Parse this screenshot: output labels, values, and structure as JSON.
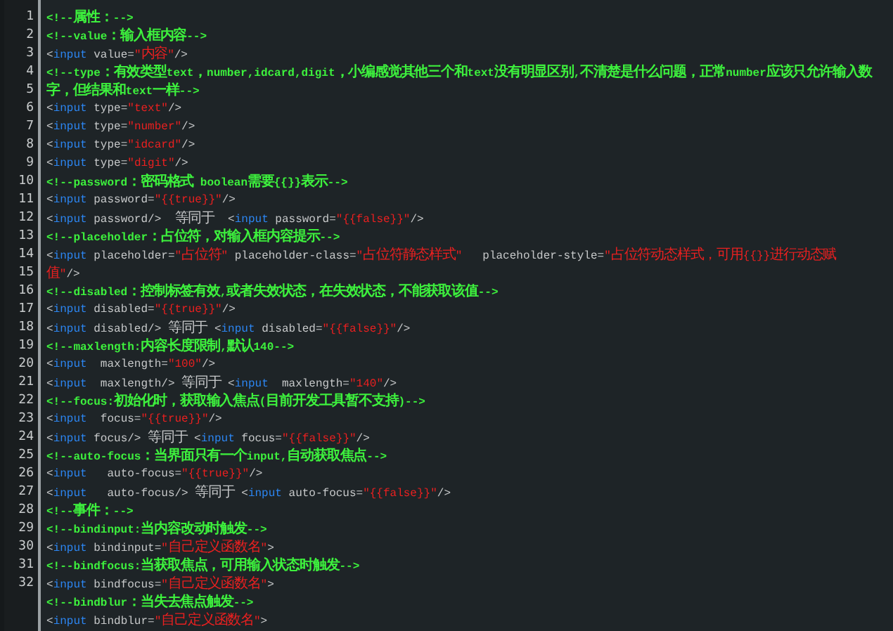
{
  "editor": {
    "rows": [
      {
        "number": "1",
        "tokens": [
          {
            "kind": "comment",
            "text": "<!--属性：-->"
          }
        ]
      },
      {
        "number": "2",
        "tokens": [
          {
            "kind": "comment",
            "text": "<!--value：输入框内容-->"
          }
        ]
      },
      {
        "number": "3",
        "tokens": [
          {
            "kind": "plain",
            "text": "<"
          },
          {
            "kind": "tag",
            "text": "input"
          },
          {
            "kind": "plain",
            "text": " value="
          },
          {
            "kind": "string",
            "text": "\"内容\""
          },
          {
            "kind": "plain",
            "text": "/>"
          }
        ]
      },
      {
        "number": "4",
        "tokens": [
          {
            "kind": "comment",
            "text": "<!--type：有效类型text，number,idcard,digit，小编感觉其他三个和text没有明显区别,不清楚是什么问题，正常number应该只允许输入数"
          }
        ]
      },
      {
        "number": "5",
        "tokens": [
          {
            "kind": "comment",
            "text": "字，但结果和text一样-->"
          }
        ]
      },
      {
        "number": "6",
        "tokens": [
          {
            "kind": "plain",
            "text": "<"
          },
          {
            "kind": "tag",
            "text": "input"
          },
          {
            "kind": "plain",
            "text": " type="
          },
          {
            "kind": "string",
            "text": "\"text\""
          },
          {
            "kind": "plain",
            "text": "/>"
          }
        ]
      },
      {
        "number": "7",
        "tokens": [
          {
            "kind": "plain",
            "text": "<"
          },
          {
            "kind": "tag",
            "text": "input"
          },
          {
            "kind": "plain",
            "text": " type="
          },
          {
            "kind": "string",
            "text": "\"number\""
          },
          {
            "kind": "plain",
            "text": "/>"
          }
        ]
      },
      {
        "number": "8",
        "tokens": [
          {
            "kind": "plain",
            "text": "<"
          },
          {
            "kind": "tag",
            "text": "input"
          },
          {
            "kind": "plain",
            "text": " type="
          },
          {
            "kind": "string",
            "text": "\"idcard\""
          },
          {
            "kind": "plain",
            "text": "/>"
          }
        ]
      },
      {
        "number": "9",
        "tokens": [
          {
            "kind": "plain",
            "text": "<"
          },
          {
            "kind": "tag",
            "text": "input"
          },
          {
            "kind": "plain",
            "text": " type="
          },
          {
            "kind": "string",
            "text": "\"digit\""
          },
          {
            "kind": "plain",
            "text": "/>"
          }
        ]
      },
      {
        "number": "10",
        "tokens": [
          {
            "kind": "comment",
            "text": "<!--password：密码格式 boolean需要{{}}表示-->"
          }
        ]
      },
      {
        "number": "11",
        "tokens": [
          {
            "kind": "plain",
            "text": "<"
          },
          {
            "kind": "tag",
            "text": "input"
          },
          {
            "kind": "plain",
            "text": " password="
          },
          {
            "kind": "string",
            "text": "\"{{true}}\""
          },
          {
            "kind": "plain",
            "text": "/>"
          }
        ]
      },
      {
        "number": "12",
        "tokens": [
          {
            "kind": "plain",
            "text": "<"
          },
          {
            "kind": "tag",
            "text": "input"
          },
          {
            "kind": "plain",
            "text": " password/>  等同于  <"
          },
          {
            "kind": "tag",
            "text": "input"
          },
          {
            "kind": "plain",
            "text": " password="
          },
          {
            "kind": "string",
            "text": "\"{{false}}\""
          },
          {
            "kind": "plain",
            "text": "/>"
          }
        ]
      },
      {
        "number": "13",
        "tokens": [
          {
            "kind": "comment",
            "text": "<!--placeholder：占位符，对输入框内容提示-->"
          }
        ]
      },
      {
        "number": "14",
        "tokens": [
          {
            "kind": "plain",
            "text": "<"
          },
          {
            "kind": "tag",
            "text": "input"
          },
          {
            "kind": "plain",
            "text": " placeholder="
          },
          {
            "kind": "string",
            "text": "\"占位符\""
          },
          {
            "kind": "plain",
            "text": " placeholder-class="
          },
          {
            "kind": "string",
            "text": "\"占位符静态样式\""
          },
          {
            "kind": "plain",
            "text": "   placeholder-style="
          },
          {
            "kind": "string",
            "text": "\"占位符动态样式，可用{{}}进行动态赋"
          }
        ]
      },
      {
        "number": "15",
        "tokens": [
          {
            "kind": "string",
            "text": "值\""
          },
          {
            "kind": "plain",
            "text": "/>"
          }
        ]
      },
      {
        "number": "16",
        "tokens": [
          {
            "kind": "comment",
            "text": "<!--disabled：控制标签有效,或者失效状态，在失效状态，不能获取该值-->"
          }
        ]
      },
      {
        "number": "17",
        "tokens": [
          {
            "kind": "plain",
            "text": "<"
          },
          {
            "kind": "tag",
            "text": "input"
          },
          {
            "kind": "plain",
            "text": " disabled="
          },
          {
            "kind": "string",
            "text": "\"{{true}}\""
          },
          {
            "kind": "plain",
            "text": "/>"
          }
        ]
      },
      {
        "number": "18",
        "tokens": [
          {
            "kind": "plain",
            "text": "<"
          },
          {
            "kind": "tag",
            "text": "input"
          },
          {
            "kind": "plain",
            "text": " disabled/> 等同于 <"
          },
          {
            "kind": "tag",
            "text": "input"
          },
          {
            "kind": "plain",
            "text": " disabled="
          },
          {
            "kind": "string",
            "text": "\"{{false}}\""
          },
          {
            "kind": "plain",
            "text": "/>"
          }
        ]
      },
      {
        "number": "19",
        "tokens": [
          {
            "kind": "comment",
            "text": "<!--maxlength:内容长度限制,默认140-->"
          }
        ]
      },
      {
        "number": "20",
        "tokens": [
          {
            "kind": "plain",
            "text": "<"
          },
          {
            "kind": "tag",
            "text": "input"
          },
          {
            "kind": "plain",
            "text": "  maxlength="
          },
          {
            "kind": "string",
            "text": "\"100\""
          },
          {
            "kind": "plain",
            "text": "/>"
          }
        ]
      },
      {
        "number": "21",
        "tokens": [
          {
            "kind": "plain",
            "text": "<"
          },
          {
            "kind": "tag",
            "text": "input"
          },
          {
            "kind": "plain",
            "text": "  maxlength/> 等同于 <"
          },
          {
            "kind": "tag",
            "text": "input"
          },
          {
            "kind": "plain",
            "text": "  maxlength="
          },
          {
            "kind": "string",
            "text": "\"140\""
          },
          {
            "kind": "plain",
            "text": "/>"
          }
        ]
      },
      {
        "number": "22",
        "tokens": [
          {
            "kind": "comment",
            "text": "<!--focus:初始化时，获取输入焦点(目前开发工具暂不支持)-->"
          }
        ]
      },
      {
        "number": "23",
        "tokens": [
          {
            "kind": "plain",
            "text": "<"
          },
          {
            "kind": "tag",
            "text": "input"
          },
          {
            "kind": "plain",
            "text": "  focus="
          },
          {
            "kind": "string",
            "text": "\"{{true}}\""
          },
          {
            "kind": "plain",
            "text": "/>"
          }
        ]
      },
      {
        "number": "24",
        "tokens": [
          {
            "kind": "plain",
            "text": "<"
          },
          {
            "kind": "tag",
            "text": "input"
          },
          {
            "kind": "plain",
            "text": " focus/> 等同于 <"
          },
          {
            "kind": "tag",
            "text": "input"
          },
          {
            "kind": "plain",
            "text": " focus="
          },
          {
            "kind": "string",
            "text": "\"{{false}}\""
          },
          {
            "kind": "plain",
            "text": "/>"
          }
        ]
      },
      {
        "number": "25",
        "tokens": [
          {
            "kind": "comment",
            "text": "<!--auto-focus：当界面只有一个input,自动获取焦点-->"
          }
        ]
      },
      {
        "number": "26",
        "tokens": [
          {
            "kind": "plain",
            "text": "<"
          },
          {
            "kind": "tag",
            "text": "input"
          },
          {
            "kind": "plain",
            "text": "   auto-focus="
          },
          {
            "kind": "string",
            "text": "\"{{true}}\""
          },
          {
            "kind": "plain",
            "text": "/>"
          }
        ]
      },
      {
        "number": "27",
        "tokens": [
          {
            "kind": "plain",
            "text": "<"
          },
          {
            "kind": "tag",
            "text": "input"
          },
          {
            "kind": "plain",
            "text": "   auto-focus/> 等同于 <"
          },
          {
            "kind": "tag",
            "text": "input"
          },
          {
            "kind": "plain",
            "text": " auto-focus="
          },
          {
            "kind": "string",
            "text": "\"{{false}}\""
          },
          {
            "kind": "plain",
            "text": "/>"
          }
        ]
      },
      {
        "number": "28",
        "tokens": [
          {
            "kind": "comment",
            "text": "<!--事件：-->"
          }
        ]
      },
      {
        "number": "29",
        "tokens": [
          {
            "kind": "comment",
            "text": "<!--bindinput:当内容改动时触发-->"
          }
        ]
      },
      {
        "number": "30",
        "tokens": [
          {
            "kind": "plain",
            "text": "<"
          },
          {
            "kind": "tag",
            "text": "input"
          },
          {
            "kind": "plain",
            "text": " bindinput="
          },
          {
            "kind": "string",
            "text": "\"自己定义函数名\""
          },
          {
            "kind": "plain",
            "text": ">"
          }
        ]
      },
      {
        "number": "31",
        "tokens": [
          {
            "kind": "comment",
            "text": "<!--bindfocus:当获取焦点，可用输入状态时触发-->"
          }
        ]
      },
      {
        "number": "32",
        "tokens": [
          {
            "kind": "plain",
            "text": "<"
          },
          {
            "kind": "tag",
            "text": "input"
          },
          {
            "kind": "plain",
            "text": " bindfocus="
          },
          {
            "kind": "string",
            "text": "\"自己定义函数名\""
          },
          {
            "kind": "plain",
            "text": ">"
          }
        ]
      },
      {
        "tokens": [
          {
            "kind": "comment",
            "text": "<!--bindblur：当失去焦点触发-->"
          }
        ]
      },
      {
        "tokens": [
          {
            "kind": "plain",
            "text": "<"
          },
          {
            "kind": "tag",
            "text": "input"
          },
          {
            "kind": "plain",
            "text": " bindblur="
          },
          {
            "kind": "string",
            "text": "\"自己定义函数名\""
          },
          {
            "kind": "plain",
            "text": ">"
          }
        ]
      }
    ]
  }
}
